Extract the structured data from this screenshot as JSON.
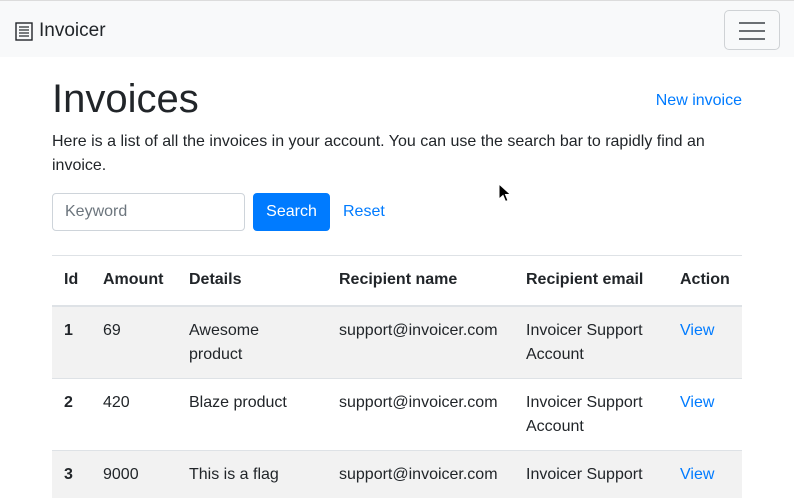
{
  "navbar": {
    "brand": "Invoicer",
    "brand_icon": "receipt-icon",
    "menu_icon": "hamburger-menu-icon"
  },
  "page": {
    "title": "Invoices",
    "new_invoice_link": "New invoice",
    "intro": "Here is a list of all the invoices in your account. You can use the search bar to rapidly find an invoice."
  },
  "search": {
    "placeholder": "Keyword",
    "value": "",
    "button_label": "Search",
    "reset_label": "Reset"
  },
  "table": {
    "headers": [
      "Id",
      "Amount",
      "Details",
      "Recipient name",
      "Recipient email",
      "Action"
    ],
    "rows": [
      {
        "id": "1",
        "amount": "69",
        "details": "Awesome product",
        "recipient_name": "support@invoicer.com",
        "recipient_email": "Invoicer Support Account",
        "action": "View"
      },
      {
        "id": "2",
        "amount": "420",
        "details": "Blaze product",
        "recipient_name": "support@invoicer.com",
        "recipient_email": "Invoicer Support Account",
        "action": "View"
      },
      {
        "id": "3",
        "amount": "9000",
        "details": "This is a flag",
        "recipient_name": "support@invoicer.com",
        "recipient_email": "Invoicer Support",
        "action": "View"
      }
    ]
  },
  "colors": {
    "link": "#007bff",
    "primary_button": "#007bff",
    "navbar_bg": "#f8f9fa",
    "stripe_bg": "#f2f2f2"
  }
}
